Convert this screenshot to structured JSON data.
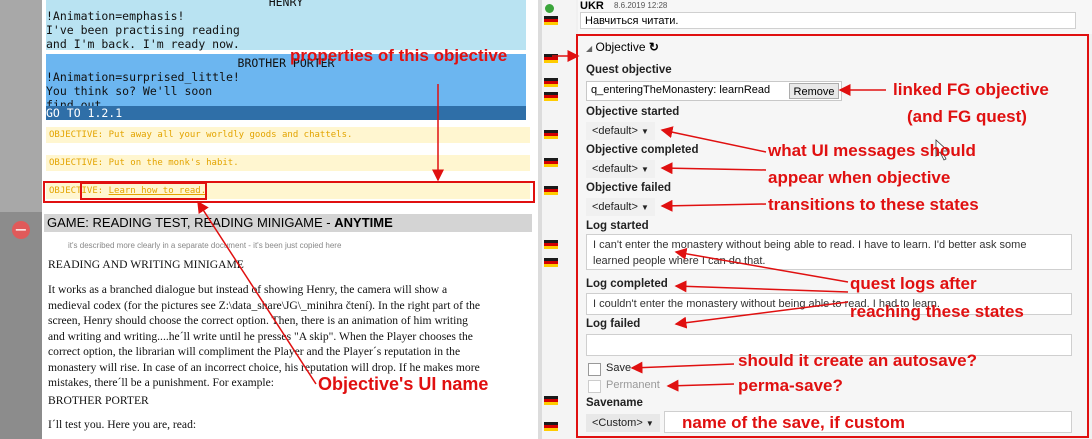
{
  "script": {
    "speeches": [
      {
        "name": "HENRY",
        "lines": [
          "!Animation=emphasis!",
          "I've been practising reading",
          "and I'm back. I'm ready now."
        ]
      },
      {
        "name": "BROTHER PORTER",
        "lines": [
          "!Animation=surprised_little!",
          "You think so? We'll soon",
          "find out."
        ]
      }
    ],
    "goto": "GO TO 1.2.1",
    "objectives": [
      "OBJECTIVE: Put away all your worldly goods and chattels.",
      "OBJECTIVE: Put on the monk's habit."
    ],
    "selected_objective_prefix": "OBJECTIVE:",
    "selected_objective_text": "Learn how to read.",
    "game_header": "GAME: READING TEST, READING MINIGAME - ",
    "game_header_bold": "ANYTIME",
    "note": "it's described more clearly in a separate document - it's been just copied here",
    "doc_title": "READING AND WRITING MINIGAME",
    "doc_paragraph": [
      "It works as a branched dialogue but instead of showing Henry, the camera will show a",
      "medieval codex (for the pictures see Z:\\data_share\\JG\\_minihra čtení). In the right part of the",
      "screen, Henry should choose the correct option. Then, there is an animation of him writing",
      "and writing and writing....he´ll write until he presses \"A skip\". When the Player chooses the",
      "correct option, the librarian will compliment the Player and the Player´s reputation in the",
      "monastery will rise. In case of an incorrect choice, his reputation will drop. If he makes more",
      "mistakes, there´ll be a punishment. For example:"
    ],
    "doc_speaker": "BROTHER PORTER",
    "doc_line": "I´ll test you. Here you are, read:"
  },
  "comment": {
    "user": "UKR",
    "date": "8.6.2019 12:28",
    "text": "Навчиться читати."
  },
  "panel": {
    "title": "Objective",
    "quest_objective_label": "Quest objective",
    "quest_objective_value": "q_enteringTheMonastery: learnRead",
    "remove_label": "Remove",
    "started_label": "Objective started",
    "started_value": "<default>",
    "completed_label": "Objective completed",
    "completed_value": "<default>",
    "failed_label": "Objective failed",
    "failed_value": "<default>",
    "log_started_label": "Log started",
    "log_started_text": "I can't enter the monastery without being able to read. I have to learn. I'd better ask some learned people where I can do that.",
    "log_completed_label": "Log completed",
    "log_completed_text": "I couldn't enter the monastery without being able to read. I had to learn.",
    "log_failed_label": "Log failed",
    "log_failed_text": "",
    "save_label": "Save",
    "permanent_label": "Permanent",
    "savename_label": "Savename",
    "savename_value": "<Custom>"
  },
  "annotations": {
    "properties": "properties of this objective",
    "linked1": "linked FG objective",
    "linked2": "(and FG quest)",
    "ui1": "what UI messages should",
    "ui2": "appear when objective",
    "ui3": "transitions to these states",
    "logs1": "quest logs after",
    "logs2": "reaching these states",
    "autosave": "should it create an autosave?",
    "perma": "perma-save?",
    "savename": "name of the save, if custom",
    "uiname": "Objective's UI name"
  },
  "colors": {
    "annotation": "#e01010",
    "speech1": "#b9e3f2",
    "speech2": "#6cb6f0",
    "objective": "#e3a400"
  }
}
